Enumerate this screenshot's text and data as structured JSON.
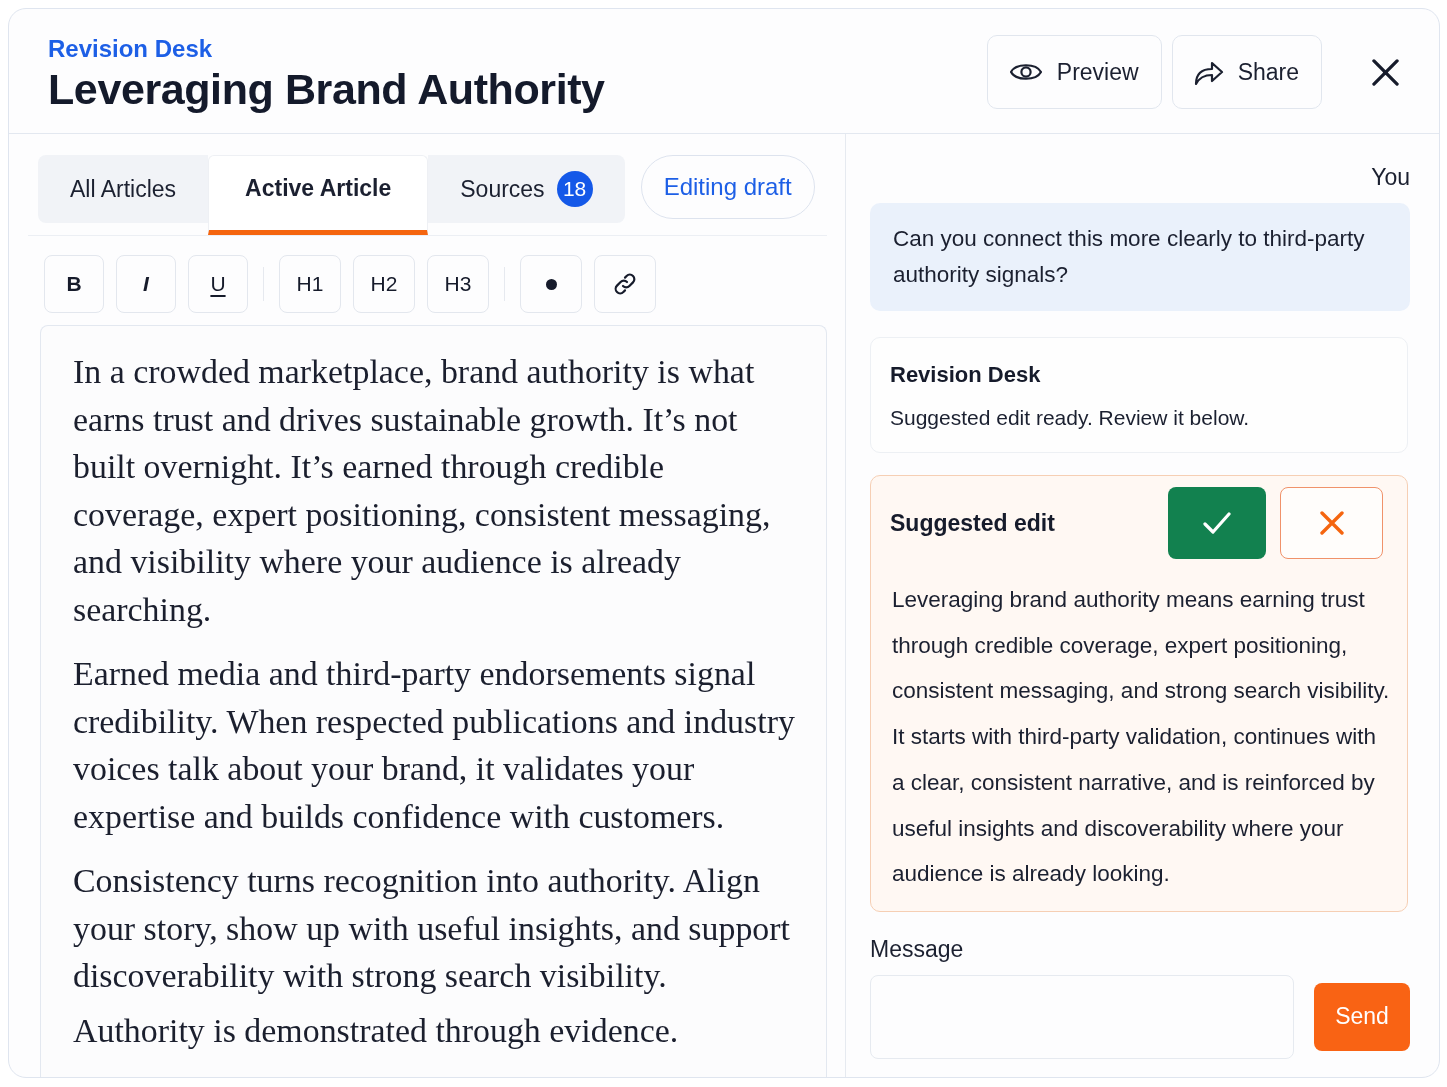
{
  "header": {
    "app_name": "Revision Desk",
    "title": "Leveraging Brand Authority",
    "actions": [
      {
        "kind": "preview",
        "label": "Preview"
      },
      {
        "kind": "share",
        "label": "Share"
      }
    ]
  },
  "tabs": [
    {
      "label": "All Articles",
      "selected": false
    },
    {
      "label": "Active Article",
      "selected": true
    },
    {
      "label": "Sources",
      "badge": "18",
      "selected": false
    }
  ],
  "status_pill": "Editing draft",
  "toolbar": [
    [
      {
        "kind": "bold",
        "label": "B"
      },
      {
        "kind": "italic",
        "label": "I"
      },
      {
        "kind": "underline",
        "label": "U"
      }
    ],
    [
      {
        "kind": "heading",
        "label": "H1"
      },
      {
        "kind": "heading",
        "label": "H2"
      },
      {
        "kind": "heading",
        "label": "H3"
      }
    ],
    [
      {
        "kind": "bullet"
      },
      {
        "kind": "link"
      }
    ]
  ],
  "editor": {
    "paragraphs": [
      "In a crowded marketplace, brand authority is what earns trust and drives sustainable growth. It’s not built overnight. It’s earned through credible coverage, expert positioning, consistent messaging, and visibility where your audience is already searching.",
      "Earned media and third-party endorsements signal credibility. When respected publications and industry voices talk about your brand, it validates your expertise and builds confidence with customers.",
      "Consistency turns recognition into authority. Align your story, show up with useful insights, and support discoverability with strong search visibility.",
      "Authority is demonstrated through evidence."
    ]
  },
  "chat": {
    "messages": [
      {
        "kind": "user",
        "author": "You",
        "text": "Can you connect this more clearly to third-party authority signals?"
      },
      {
        "kind": "assistant",
        "author": "Revision Desk",
        "text": "Suggested edit ready. Review it below."
      }
    ],
    "suggestion": {
      "title": "Suggested edit",
      "text": "Leveraging brand authority means earning trust through credible coverage, expert positioning, consistent messaging, and strong search visibility. It starts with third-party validation, continues with a clear, consistent narrative, and is reinforced by useful insights and discoverability where your audience is already looking."
    },
    "composer": {
      "label": "Message",
      "send_label": "Send"
    }
  }
}
